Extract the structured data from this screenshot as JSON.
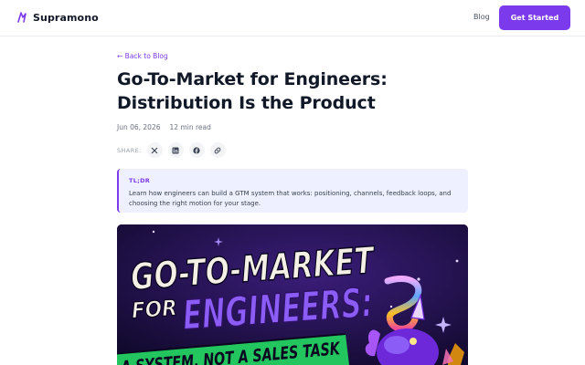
{
  "header": {
    "brand": "Supramono",
    "nav_blog": "Blog",
    "cta_label": "Get Started"
  },
  "article": {
    "back_link": "← Back to Blog",
    "title": "Go-To-Market for Engineers: Distribution Is the Product",
    "date": "Jun 06, 2026",
    "read_time": "12 min read"
  },
  "share": {
    "label": "SHARE:",
    "icons": [
      "x-icon",
      "linkedin-icon",
      "facebook-icon",
      "link-icon"
    ]
  },
  "tldr": {
    "label": "TL;DR",
    "text": "Learn how engineers can build a GTM system that works: positioning, channels, feedback loops, and choosing the right motion for your stage."
  },
  "hero": {
    "line1": "GO-TO-MARKET",
    "line2_a": "FOR",
    "line2_b": "ENGINEERS:",
    "line3": "A SYSTEM, NOT A SALES TASK"
  },
  "colors": {
    "accent": "#7c3aed",
    "tldr_bg": "#eef0ff",
    "hero_bg": "#1c1040"
  }
}
